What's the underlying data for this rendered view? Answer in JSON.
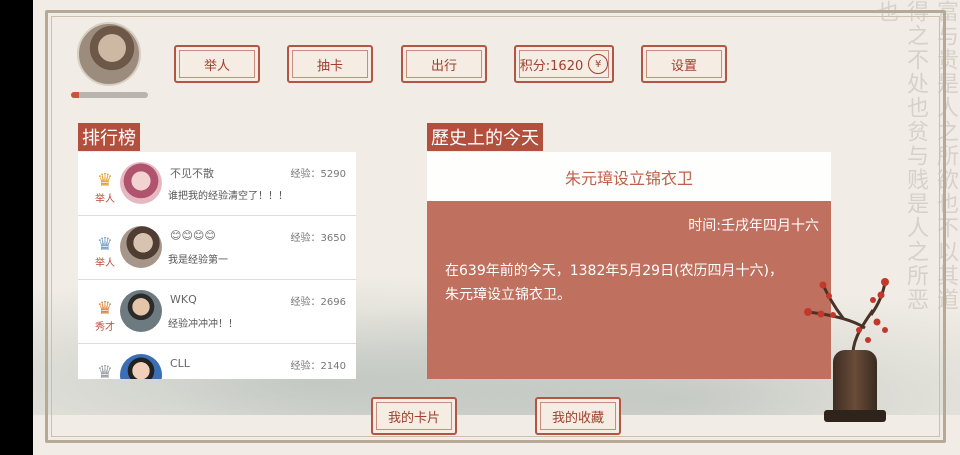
{
  "header": {
    "buttons": [
      "举人",
      "抽卡",
      "出行",
      "积分:1620",
      "设置"
    ],
    "coin_icon": "¥",
    "xp_progress": 0.1
  },
  "leaderboard": {
    "title": "排行榜",
    "xp_label": "经验：",
    "rows": [
      {
        "rank_title": "举人",
        "name": "不见不散",
        "xp": "5290",
        "signature": "谁把我的经验清空了！！！",
        "crown_color": "#e0a63a"
      },
      {
        "rank_title": "举人",
        "name": "😊😊😊😊",
        "xp": "3650",
        "signature": "我是经验第一",
        "crown_color": "#7ea2c9"
      },
      {
        "rank_title": "秀才",
        "name": "WKQ",
        "xp": "2696",
        "signature": "经验冲冲冲！！",
        "crown_color": "#d98a4a"
      },
      {
        "rank_title": "",
        "name": "CLL",
        "xp": "2140",
        "signature": "",
        "crown_color": "#9aa0a8"
      }
    ]
  },
  "history": {
    "title": "歷史上的今天",
    "event_title": "朱元璋设立锦衣卫",
    "time": "时间:壬戌年四月十六",
    "description": "在639年前的今天，1382年5月29日(农历四月十六)，朱元璋设立锦衣卫。"
  },
  "footer": {
    "my_cards": "我的卡片",
    "my_favorites": "我的收藏"
  },
  "colors": {
    "accent": "#b3503d",
    "panel": "#c0705f"
  }
}
